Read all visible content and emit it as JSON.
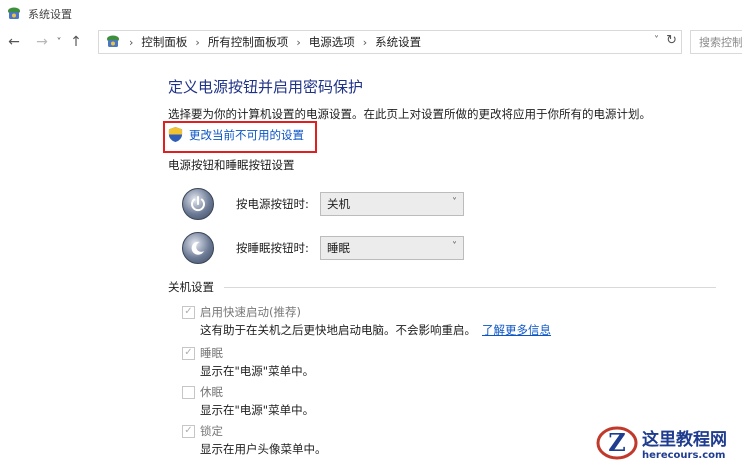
{
  "window": {
    "title": "系统设置"
  },
  "nav": {
    "back": "←",
    "forward": "→",
    "recent": "˅",
    "up": "↑"
  },
  "address": {
    "breadcrumbs": [
      "控制面板",
      "所有控制面板项",
      "电源选项",
      "系统设置"
    ],
    "dropdown": "˅",
    "refresh": "↻"
  },
  "search": {
    "placeholder": "搜索控制"
  },
  "page": {
    "title": "定义电源按钮并启用密码保护",
    "subtitle": "选择要为你的计算机设置的电源设置。在此页上对设置所做的更改将应用于你所有的电源计划。",
    "change_link": "更改当前不可用的设置"
  },
  "power_section": {
    "title": "电源按钮和睡眠按钮设置",
    "rows": [
      {
        "label": "按电源按钮时:",
        "value": "关机"
      },
      {
        "label": "按睡眠按钮时:",
        "value": "睡眠"
      }
    ]
  },
  "shutdown_section": {
    "title": "关机设置",
    "options": [
      {
        "label": "启用快速启动(推荐)",
        "checked": true,
        "desc": "这有助于在关机之后更快地启动电脑。不会影响重启。",
        "link": "了解更多信息"
      },
      {
        "label": "睡眠",
        "checked": true,
        "desc": "显示在\"电源\"菜单中。",
        "link": ""
      },
      {
        "label": "休眠",
        "checked": false,
        "desc": "显示在\"电源\"菜单中。",
        "link": ""
      },
      {
        "label": "锁定",
        "checked": true,
        "desc": "显示在用户头像菜单中。",
        "link": ""
      }
    ]
  },
  "watermark": {
    "name": "这里教程网",
    "url": "herecours.com"
  },
  "colors": {
    "accent_title": "#1e3287",
    "link": "#0b55c4",
    "highlight_box": "#e02020"
  },
  "icons": {
    "app": "control-panel-icon",
    "shield": "uac-shield-icon",
    "power": "power-icon",
    "sleep": "moon-icon"
  }
}
